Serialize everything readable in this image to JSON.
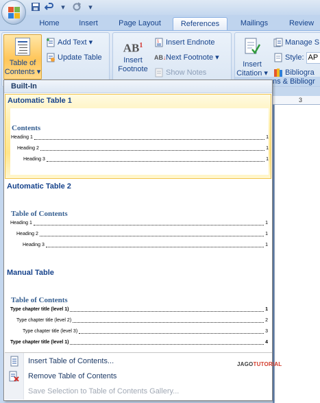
{
  "qat": {
    "save_icon": "save-icon",
    "undo_icon": "undo-icon",
    "redo_icon": "redo-icon",
    "customize_glyph": "▾"
  },
  "tabs": [
    {
      "label": "Home",
      "active": false
    },
    {
      "label": "Insert",
      "active": false
    },
    {
      "label": "Page Layout",
      "active": false
    },
    {
      "label": "References",
      "active": true
    },
    {
      "label": "Mailings",
      "active": false
    },
    {
      "label": "Review",
      "active": false
    }
  ],
  "ribbon": {
    "toc_button": {
      "line1": "Table of",
      "line2": "Contents ▾"
    },
    "add_text": "Add Text ▾",
    "update_table": "Update Table",
    "insert_footnote": {
      "line1": "Insert",
      "line2": "Footnote"
    },
    "footnote_glyph": "AB",
    "footnote_sup": "1",
    "insert_endnote": "Insert Endnote",
    "next_footnote": "Next Footnote ▾",
    "show_notes": "Show Notes",
    "insert_citation": {
      "line1": "Insert",
      "line2": "Citation ▾"
    },
    "manage_sources": "Manage S",
    "style_label": "Style:",
    "style_value": "AP",
    "bibliography": "Bibliogra",
    "citations_group_label": "ns & Bibliogr"
  },
  "ruler": {
    "mark": "3"
  },
  "dropdown": {
    "section_header": "Built-In",
    "items": [
      {
        "title": "Automatic Table 1",
        "heading": "Contents",
        "lines": [
          {
            "label": "Heading 1",
            "num": "1",
            "level": 1,
            "bold": false
          },
          {
            "label": "Heading 2",
            "num": "1",
            "level": 2,
            "bold": false
          },
          {
            "label": "Heading 3",
            "num": "1",
            "level": 3,
            "bold": false
          }
        ]
      },
      {
        "title": "Automatic Table 2",
        "heading": "Table of Contents",
        "lines": [
          {
            "label": "Heading 1",
            "num": "1",
            "level": 1,
            "bold": false
          },
          {
            "label": "Heading 2",
            "num": "1",
            "level": 2,
            "bold": false
          },
          {
            "label": "Heading 3",
            "num": "1",
            "level": 3,
            "bold": false
          }
        ]
      },
      {
        "title": "Manual Table",
        "heading": "Table of Contents",
        "lines": [
          {
            "label": "Type chapter title (level 1)",
            "num": "1",
            "level": 1,
            "bold": true
          },
          {
            "label": "Type chapter title (level 2)",
            "num": "2",
            "level": 2,
            "bold": false
          },
          {
            "label": "Type chapter title (level 3)",
            "num": "3",
            "level": 3,
            "bold": false
          },
          {
            "label": "Type chapter title (level 1)",
            "num": "4",
            "level": 1,
            "bold": true
          }
        ]
      }
    ],
    "menu": [
      {
        "label": "Insert Table of Contents...",
        "icon": "document-icon",
        "disabled": false
      },
      {
        "label": "Remove Table of Contents",
        "icon": "remove-document-icon",
        "disabled": false
      },
      {
        "label": "Save Selection to Table of Contents Gallery...",
        "icon": "save-to-gallery-icon",
        "disabled": true
      }
    ],
    "watermark": {
      "part1": "JAGO",
      "part2": "TUTORIAL"
    }
  },
  "colors": {
    "ribbon_text": "#15428b",
    "selected_item_bg": "#ffe58a",
    "toc_heading": "#365f91"
  }
}
